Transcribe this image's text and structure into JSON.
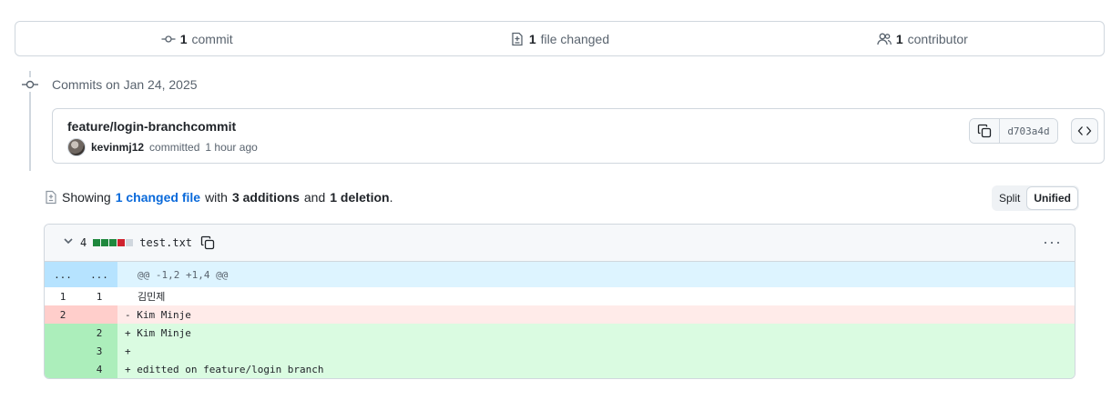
{
  "summary": {
    "commits_count": "1",
    "commits_label": "commit",
    "files_count": "1",
    "files_label": "file changed",
    "contributors_count": "1",
    "contributors_label": "contributor"
  },
  "timeline": {
    "date_heading": "Commits on Jan 24, 2025"
  },
  "commit": {
    "title": "feature/login-branchcommit",
    "author": "kevinmj12",
    "action": "committed",
    "time": "1 hour ago",
    "sha": "d703a4d"
  },
  "showing": {
    "prefix": "Showing",
    "changed_files": "1 changed file",
    "with": "with",
    "additions": "3 additions",
    "and": "and",
    "deletions": "1 deletion",
    "period": "."
  },
  "view_toggle": {
    "split": "Split",
    "unified": "Unified",
    "active": "Unified"
  },
  "file": {
    "change_count": "4",
    "name": "test.txt",
    "diffstat": [
      "add",
      "add",
      "add",
      "del",
      "neutral"
    ],
    "colors": {
      "add": "#1f883d",
      "del": "#cf222e",
      "neutral": "#d0d7de"
    },
    "menu_icon": "kebab-horizontal-icon"
  },
  "diff": {
    "hunk": {
      "old": "...",
      "new": "...",
      "text": "@@ -1,2 +1,4 @@"
    },
    "lines": [
      {
        "type": "ctx",
        "old": "1",
        "new": "1",
        "text": "김민제"
      },
      {
        "type": "del",
        "old": "2",
        "new": "",
        "text": "- Kim Minje"
      },
      {
        "type": "add",
        "old": "",
        "new": "2",
        "text": "+ Kim Minje"
      },
      {
        "type": "add",
        "old": "",
        "new": "3",
        "text": "+"
      },
      {
        "type": "add",
        "old": "",
        "new": "4",
        "text": "+ editted on feature/login branch"
      }
    ]
  }
}
